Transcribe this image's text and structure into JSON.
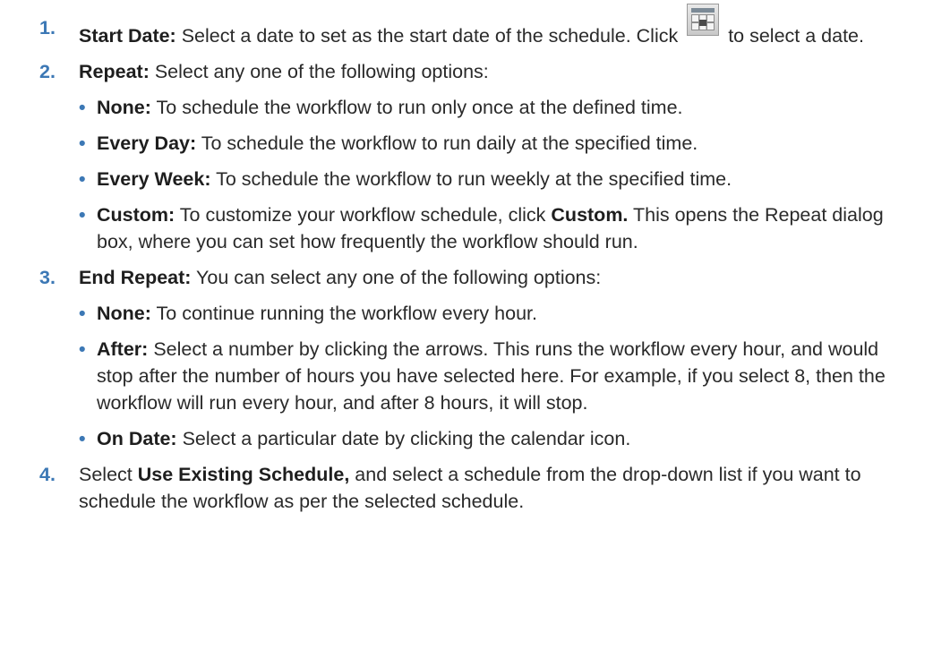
{
  "steps": [
    {
      "num": "1.",
      "label": "Start Date:",
      "text_before_icon": " Select a date to set as the start date of the schedule. Click ",
      "icon": "calendar-icon",
      "text_after_icon": " to select a date."
    },
    {
      "num": "2.",
      "label": "Repeat:",
      "text": " Select any one of the following options:",
      "bullets": [
        {
          "label": "None:",
          "text": " To schedule the workflow to run only once at the defined time."
        },
        {
          "label": "Every Day:",
          "text": " To schedule the workflow to run daily at the specified time."
        },
        {
          "label": "Every Week:",
          "text": " To schedule the workflow to run weekly at the specified time."
        },
        {
          "label": "Custom:",
          "text": " To customize your workflow schedule, click ",
          "bold2": "Custom.",
          "text2": " This opens the Repeat dialog box, where you can set how frequently the workflow should run."
        }
      ]
    },
    {
      "num": "3.",
      "label": "End Repeat:",
      "text": " You can select any one of the following options:",
      "bullets": [
        {
          "label": "None:",
          "text": " To continue running the workflow every hour."
        },
        {
          "label": "After:",
          "text": " Select a number by clicking the arrows. This runs the workflow every hour, and would stop after the number of hours you have selected here. For example, if you select 8, then the workflow will run every hour, and after 8 hours, it will stop."
        },
        {
          "label": "On Date:",
          "text": " Select a particular date by clicking the calendar icon."
        }
      ]
    },
    {
      "num": "4.",
      "text_before": "Select ",
      "bold": "Use Existing Schedule,",
      "text_after": " and select a schedule from the drop-down list if you want to schedule the workflow as per the selected schedule."
    }
  ],
  "bullet_char": "•",
  "colors": {
    "accent": "#3c78b5",
    "text": "#2a2a2a"
  }
}
